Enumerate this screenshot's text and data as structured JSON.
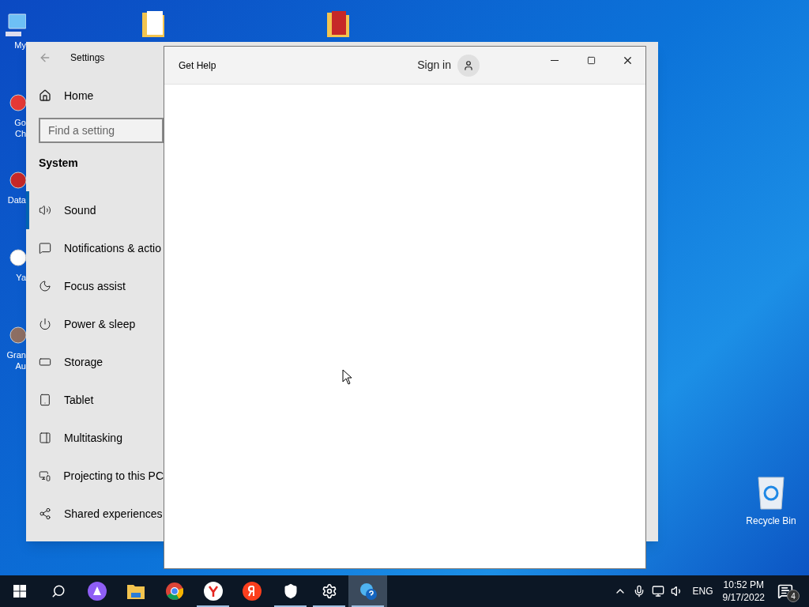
{
  "desktop_icons": [
    {
      "label_lines": [
        "My"
      ]
    },
    {
      "label_lines": [
        "Go",
        "Ch"
      ]
    },
    {
      "label_lines": [
        "Data"
      ]
    },
    {
      "label_lines": [
        "Ya"
      ]
    },
    {
      "label_lines": [
        "Gran",
        "Au"
      ]
    }
  ],
  "recycle_bin": {
    "label": "Recycle Bin"
  },
  "settings_window": {
    "title": "Settings",
    "home": "Home",
    "search": {
      "placeholder": "Find a setting"
    },
    "section": "System",
    "items": [
      {
        "label": "Sound",
        "selected": true
      },
      {
        "label": "Notifications & actio",
        "selected": false
      },
      {
        "label": "Focus assist",
        "selected": false
      },
      {
        "label": "Power & sleep",
        "selected": false
      },
      {
        "label": "Storage",
        "selected": false
      },
      {
        "label": "Tablet",
        "selected": false
      },
      {
        "label": "Multitasking",
        "selected": false
      },
      {
        "label": "Projecting to this PC",
        "selected": false
      },
      {
        "label": "Shared experiences",
        "selected": false
      }
    ]
  },
  "help_window": {
    "title": "Get Help",
    "sign_in": "Sign in"
  },
  "taskbar": {
    "apps": [
      {
        "kind": "start",
        "running": false,
        "active": false
      },
      {
        "kind": "search",
        "running": false,
        "active": false
      },
      {
        "kind": "assistant",
        "running": false,
        "active": false
      },
      {
        "kind": "explorer",
        "running": false,
        "active": false
      },
      {
        "kind": "chrome",
        "running": false,
        "active": false
      },
      {
        "kind": "ybrowser",
        "running": true,
        "active": false
      },
      {
        "kind": "yandex",
        "running": false,
        "active": false
      },
      {
        "kind": "security",
        "running": true,
        "active": false
      },
      {
        "kind": "settings",
        "running": true,
        "active": false
      },
      {
        "kind": "help",
        "running": true,
        "active": true
      }
    ],
    "language": "ENG",
    "time": "10:52 PM",
    "date": "9/17/2022",
    "notifications": "4"
  }
}
